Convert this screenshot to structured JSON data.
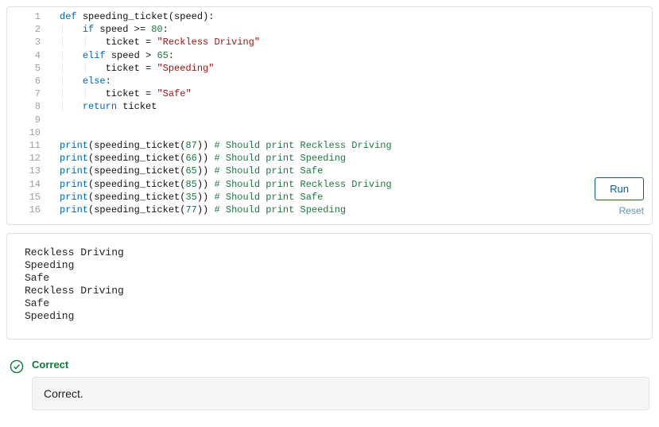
{
  "editor": {
    "lines": [
      {
        "n": 1,
        "indent": 0,
        "tokens": [
          [
            "kw",
            "def "
          ],
          [
            "name",
            "speeding_ticket"
          ],
          [
            "op",
            "("
          ],
          [
            "name",
            "speed"
          ],
          [
            "op",
            "):"
          ]
        ]
      },
      {
        "n": 2,
        "indent": 1,
        "tokens": [
          [
            "kw",
            "if"
          ],
          [
            "op",
            " "
          ],
          [
            "name",
            "speed"
          ],
          [
            "op",
            " >= "
          ],
          [
            "num",
            "80"
          ],
          [
            "op",
            ":"
          ]
        ]
      },
      {
        "n": 3,
        "indent": 2,
        "tokens": [
          [
            "name",
            "ticket"
          ],
          [
            "op",
            " = "
          ],
          [
            "str",
            "\"Reckless Driving\""
          ]
        ]
      },
      {
        "n": 4,
        "indent": 1,
        "tokens": [
          [
            "kw",
            "elif"
          ],
          [
            "op",
            " "
          ],
          [
            "name",
            "speed"
          ],
          [
            "op",
            " > "
          ],
          [
            "num",
            "65"
          ],
          [
            "op",
            ":"
          ]
        ]
      },
      {
        "n": 5,
        "indent": 2,
        "tokens": [
          [
            "name",
            "ticket"
          ],
          [
            "op",
            " = "
          ],
          [
            "str",
            "\"Speeding\""
          ]
        ]
      },
      {
        "n": 6,
        "indent": 1,
        "tokens": [
          [
            "kw",
            "else"
          ],
          [
            "op",
            ":"
          ]
        ]
      },
      {
        "n": 7,
        "indent": 2,
        "tokens": [
          [
            "name",
            "ticket"
          ],
          [
            "op",
            " = "
          ],
          [
            "str",
            "\"Safe\""
          ]
        ]
      },
      {
        "n": 8,
        "indent": 1,
        "tokens": [
          [
            "kw",
            "return"
          ],
          [
            "op",
            " "
          ],
          [
            "name",
            "ticket"
          ]
        ]
      },
      {
        "n": 9,
        "indent": 0,
        "tokens": []
      },
      {
        "n": 10,
        "indent": 0,
        "tokens": []
      },
      {
        "n": 11,
        "indent": 0,
        "tokens": [
          [
            "builtin",
            "print"
          ],
          [
            "op",
            "("
          ],
          [
            "name",
            "speeding_ticket"
          ],
          [
            "op",
            "("
          ],
          [
            "num",
            "87"
          ],
          [
            "op",
            "))"
          ],
          [
            "op",
            " "
          ],
          [
            "com",
            "# Should print Reckless Driving"
          ]
        ]
      },
      {
        "n": 12,
        "indent": 0,
        "tokens": [
          [
            "builtin",
            "print"
          ],
          [
            "op",
            "("
          ],
          [
            "name",
            "speeding_ticket"
          ],
          [
            "op",
            "("
          ],
          [
            "num",
            "66"
          ],
          [
            "op",
            "))"
          ],
          [
            "op",
            " "
          ],
          [
            "com",
            "# Should print Speeding"
          ]
        ]
      },
      {
        "n": 13,
        "indent": 0,
        "tokens": [
          [
            "builtin",
            "print"
          ],
          [
            "op",
            "("
          ],
          [
            "name",
            "speeding_ticket"
          ],
          [
            "op",
            "("
          ],
          [
            "num",
            "65"
          ],
          [
            "op",
            "))"
          ],
          [
            "op",
            " "
          ],
          [
            "com",
            "# Should print Safe"
          ]
        ]
      },
      {
        "n": 14,
        "indent": 0,
        "tokens": [
          [
            "builtin",
            "print"
          ],
          [
            "op",
            "("
          ],
          [
            "name",
            "speeding_ticket"
          ],
          [
            "op",
            "("
          ],
          [
            "num",
            "85"
          ],
          [
            "op",
            "))"
          ],
          [
            "op",
            " "
          ],
          [
            "com",
            "# Should print Reckless Driving"
          ]
        ]
      },
      {
        "n": 15,
        "indent": 0,
        "tokens": [
          [
            "builtin",
            "print"
          ],
          [
            "op",
            "("
          ],
          [
            "name",
            "speeding_ticket"
          ],
          [
            "op",
            "("
          ],
          [
            "num",
            "35"
          ],
          [
            "op",
            "))"
          ],
          [
            "op",
            " "
          ],
          [
            "com",
            "# Should print Safe"
          ]
        ]
      },
      {
        "n": 16,
        "indent": 0,
        "tokens": [
          [
            "builtin",
            "print"
          ],
          [
            "op",
            "("
          ],
          [
            "name",
            "speeding_ticket"
          ],
          [
            "op",
            "("
          ],
          [
            "num",
            "77"
          ],
          [
            "op",
            "))"
          ],
          [
            "op",
            " "
          ],
          [
            "com",
            "# Should print Speeding"
          ]
        ]
      }
    ],
    "actions": {
      "run_label": "Run",
      "reset_label": "Reset"
    }
  },
  "output": {
    "lines": [
      "Reckless Driving",
      "Speeding",
      "Safe",
      "Reckless Driving",
      "Safe",
      "Speeding"
    ]
  },
  "feedback": {
    "title": "Correct",
    "message": "Correct."
  }
}
